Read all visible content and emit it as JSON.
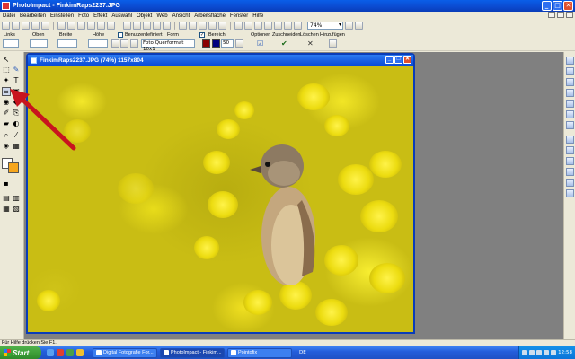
{
  "app": {
    "title": "PhotoImpact - FinkimRaps2237.JPG"
  },
  "window_buttons": {
    "minimize": "_",
    "maximize": "□",
    "close": "✕"
  },
  "menu": {
    "items": [
      "Datei",
      "Bearbeiten",
      "Einstellen",
      "Foto",
      "Effekt",
      "Auswahl",
      "Objekt",
      "Web",
      "Ansicht",
      "Arbeitsfläche",
      "Fenster",
      "Hilfe"
    ]
  },
  "toolbar": {
    "zoom_value": "74%"
  },
  "options_bar": {
    "links_label": "Links",
    "oben_label": "Oben",
    "breite_label": "Breite",
    "hoehe_label": "Höhe",
    "benutzerdefiniert_label": "Benutzerdefiniert",
    "form_label": "Form",
    "form_value": "Foto Querformat 10x1",
    "bereich_label": "Bereich",
    "bereich_value": "50",
    "optionen_label": "Optionen",
    "zuschneiden_label": "Zuschneiden",
    "loeschen_label": "Löschen",
    "hinzufuegen_label": "Hinzufügen",
    "accent_color": "#8b0000",
    "secondary_color": "#000080"
  },
  "document": {
    "title": "FinkimRaps2237.JPG (74%) 1157x804"
  },
  "tool_colors": {
    "foreground": "#ffffff",
    "background": "#f6a61d"
  },
  "statusbar": {
    "text": "Für Hilfe drücken Sie F1."
  },
  "taskbar": {
    "start_label": "Start",
    "tasks": [
      {
        "label": "Digital Fotografie For...",
        "active": false
      },
      {
        "label": "PhotoImpact - Finkim...",
        "active": true
      },
      {
        "label": "Pointofix",
        "active": false
      }
    ],
    "language": "DE",
    "clock": "12:58"
  }
}
